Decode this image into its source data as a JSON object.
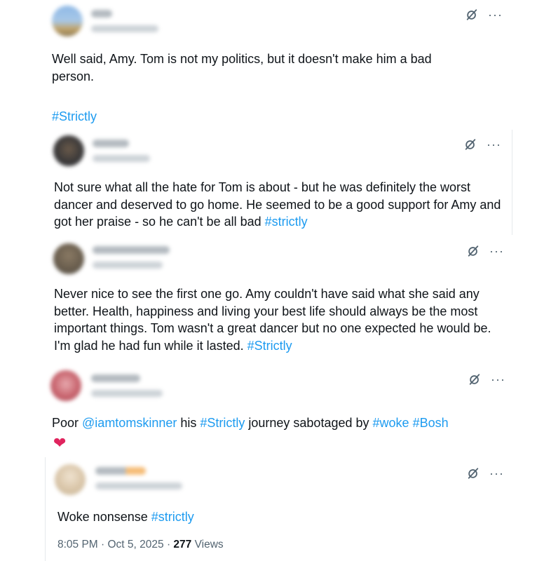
{
  "replies": [
    {
      "text_parts": [
        {
          "t": "Well said, Amy. Tom is not my politics, but it doesn't make him a bad person.",
          "tag": false
        }
      ],
      "extra_line": "#Strictly"
    },
    {
      "text_parts": [
        {
          "t": "Not sure what all the hate for Tom is about - but he was definitely the worst dancer and deserved to go home. He seemed to be a good support for Amy and got her praise - so he can't be all bad ",
          "tag": false
        },
        {
          "t": "#strictly",
          "tag": true
        }
      ]
    },
    {
      "text_parts": [
        {
          "t": "Never nice to see the first one go. Amy couldn't have said what she said any better. Health, happiness and living your best life should always be the most important things. Tom wasn't a great dancer but no one expected he would be. I'm glad he had fun while it lasted. ",
          "tag": false
        },
        {
          "t": "#Strictly",
          "tag": true
        }
      ]
    },
    {
      "text_parts": [
        {
          "t": "Poor ",
          "tag": false
        },
        {
          "t": "@iamtomskinner",
          "tag": true
        },
        {
          "t": " his ",
          "tag": false
        },
        {
          "t": "#Strictly",
          "tag": true
        },
        {
          "t": " journey sabotaged by ",
          "tag": false
        },
        {
          "t": "#woke",
          "tag": true
        },
        {
          "t": " ",
          "tag": false
        },
        {
          "t": "#Bosh",
          "tag": true
        }
      ],
      "emoji": "❤"
    },
    {
      "text_parts": [
        {
          "t": "Woke nonsense ",
          "tag": false
        },
        {
          "t": "#strictly",
          "tag": true
        }
      ],
      "meta": {
        "time": "8:05 PM · Oct 5, 2025 · ",
        "views": "277",
        "views_label": " Views"
      }
    }
  ],
  "icons": {
    "grok": "grok-slash-icon",
    "more": "more-dots-icon"
  },
  "more_glyph": "···",
  "colors": {
    "link": "#1d9bf0",
    "text": "#0f1419",
    "muted": "#536471",
    "heart": "#e0245e"
  }
}
